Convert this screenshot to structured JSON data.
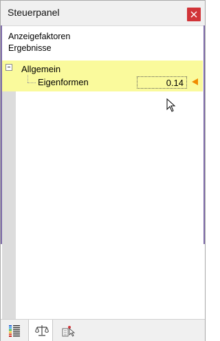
{
  "window": {
    "title": "Steuerpanel"
  },
  "header": {
    "line1": "Anzeigefaktoren",
    "line2": "Ergebnisse"
  },
  "tree": {
    "group_label": "Allgemein",
    "item_label": "Eigenformen",
    "item_value": "0.14"
  },
  "colors": {
    "highlight": "#fafa9c",
    "close": "#d13438",
    "marker": "#f08c00",
    "accent": "#7d6aa8"
  },
  "bottom_tabs": [
    {
      "icon": "color-scale-icon"
    },
    {
      "icon": "balance-scale-icon",
      "active": true
    },
    {
      "icon": "selection-cursor-icon"
    }
  ]
}
